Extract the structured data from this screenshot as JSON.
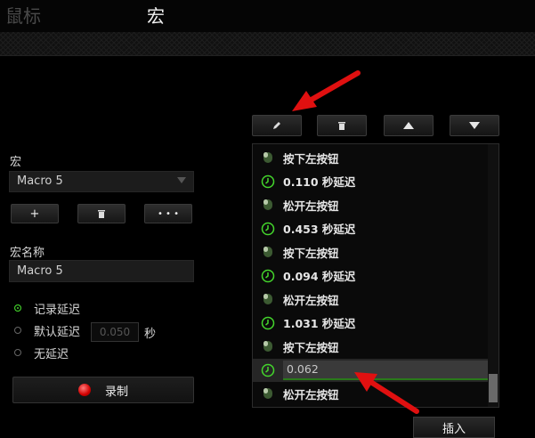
{
  "tabs": {
    "mouse": "鼠标",
    "macro": "宏"
  },
  "macro": {
    "section_label": "宏",
    "selected": "Macro 5",
    "add_label": "+",
    "more_label": "• • •",
    "name_label": "宏名称",
    "name_value": "Macro 5"
  },
  "delay_options": {
    "record": "记录延迟",
    "default": "默认延迟",
    "default_value": "0.050",
    "unit": "秒",
    "none": "无延迟"
  },
  "record_button": "录制",
  "insert_button": "插入",
  "list_items": [
    {
      "type": "mouse",
      "text": "按下左按钮"
    },
    {
      "type": "delay",
      "text": "0.110 秒延迟"
    },
    {
      "type": "mouse",
      "text": "松开左按钮"
    },
    {
      "type": "delay",
      "text": "0.453 秒延迟"
    },
    {
      "type": "mouse",
      "text": "按下左按钮"
    },
    {
      "type": "delay",
      "text": "0.094 秒延迟"
    },
    {
      "type": "mouse",
      "text": "松开左按钮"
    },
    {
      "type": "delay",
      "text": "1.031 秒延迟"
    },
    {
      "type": "mouse",
      "text": "按下左按钮"
    },
    {
      "type": "delay-edit",
      "text": "0.062"
    },
    {
      "type": "mouse",
      "text": "松开左按钮"
    }
  ],
  "colors": {
    "accent": "#44d62c",
    "record": "#e00000",
    "annotation": "#e01010"
  }
}
